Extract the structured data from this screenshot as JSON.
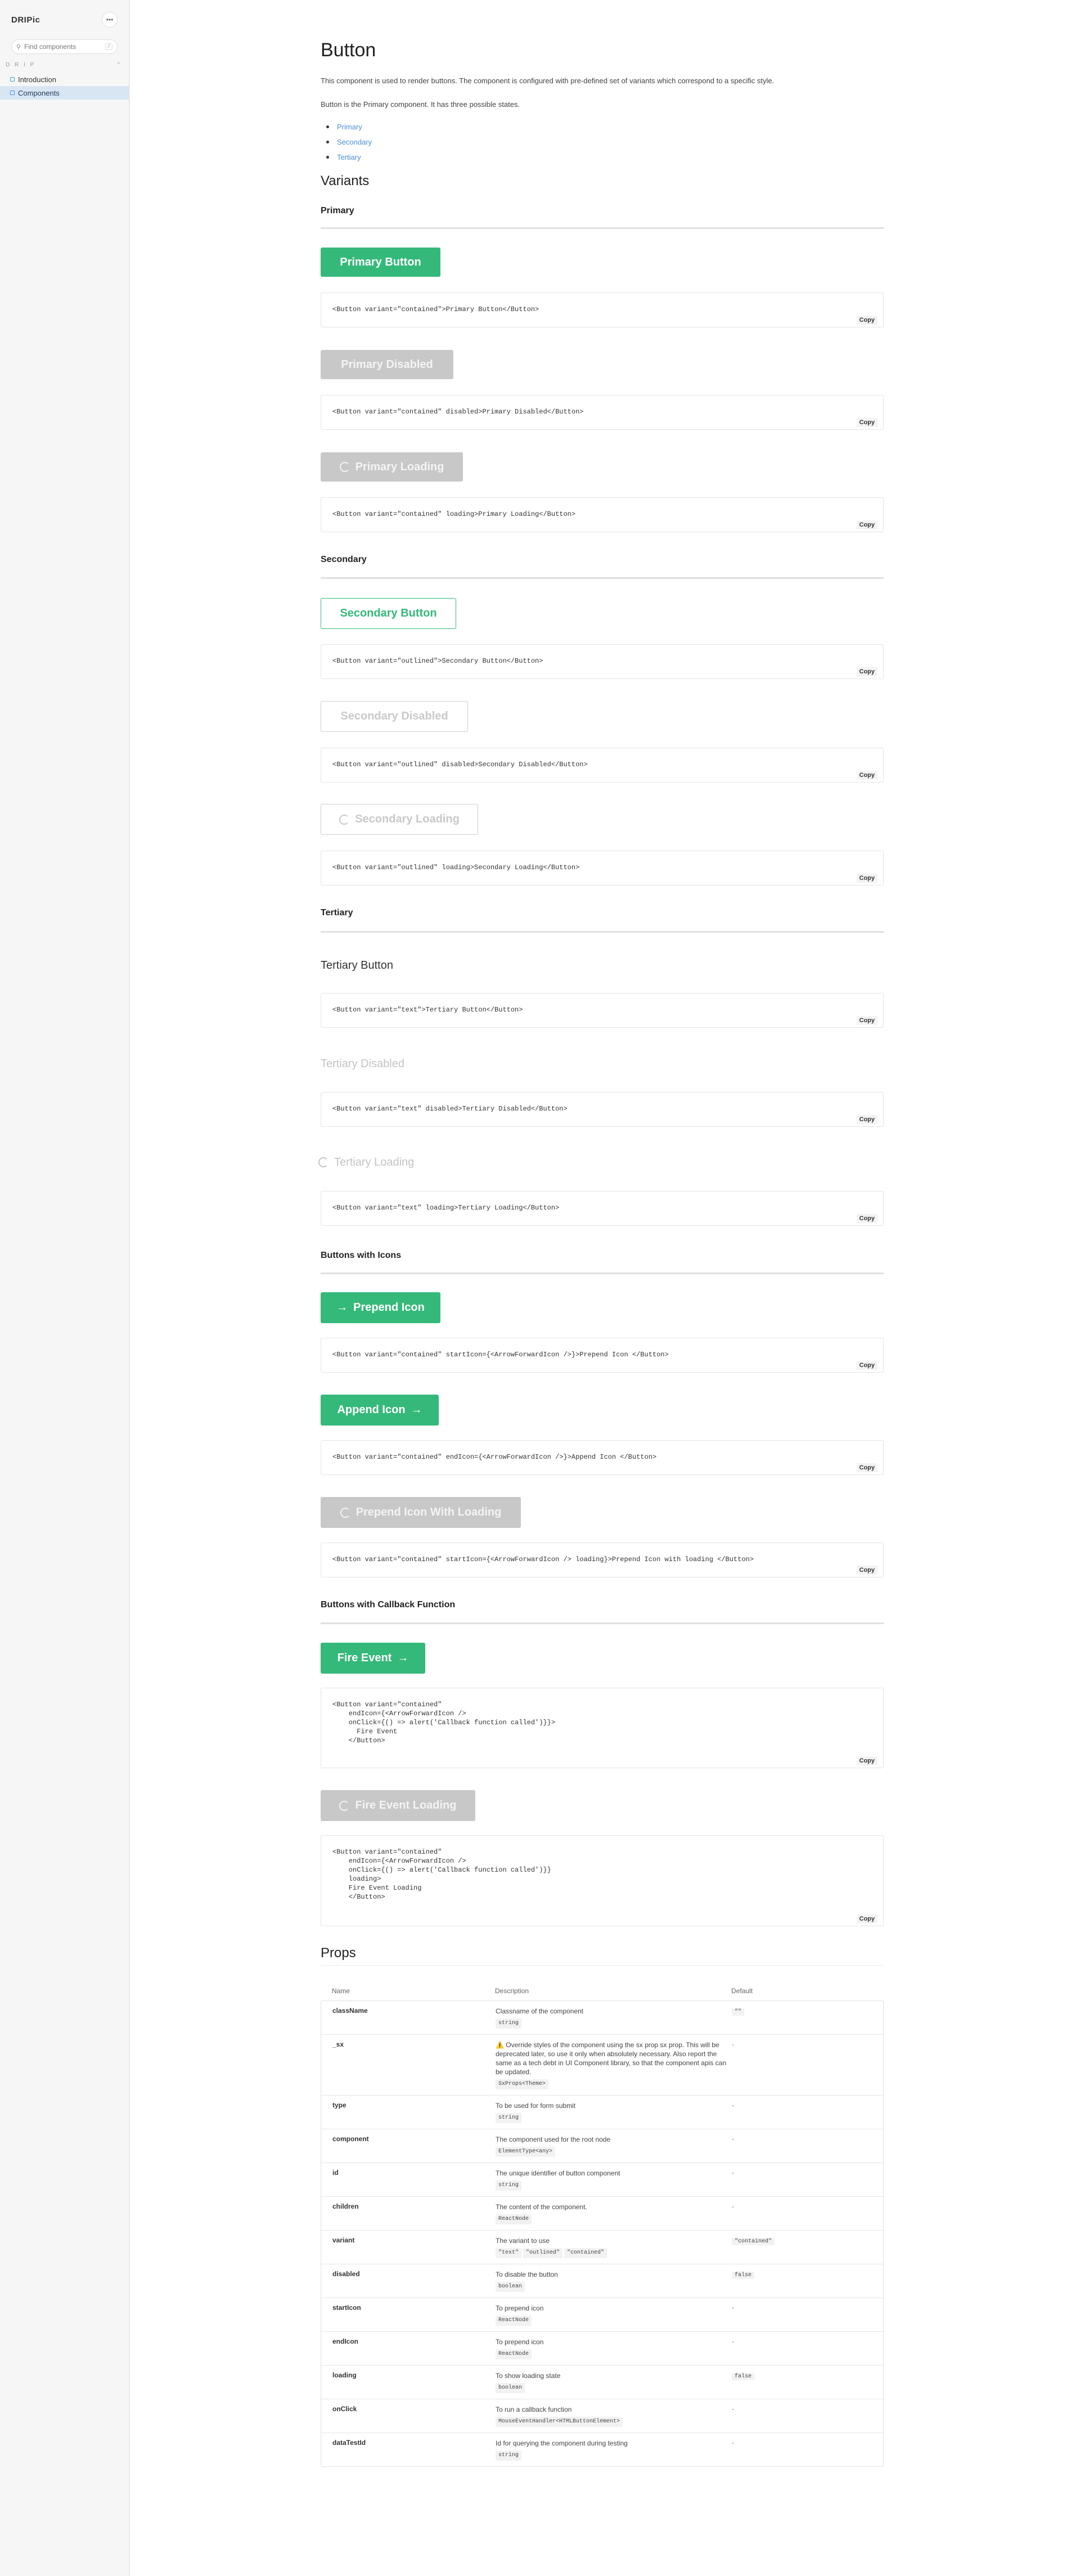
{
  "sidebar": {
    "brand": "DRIPic",
    "menu_icon": "ellipsis-icon",
    "search_placeholder": "Find components",
    "search_kbd": "/",
    "group_label": "D R I P",
    "items": [
      {
        "label": "Introduction",
        "active": false
      },
      {
        "label": "Components",
        "active": true
      }
    ]
  },
  "page": {
    "title": "Button",
    "intro": "This component is used to render buttons. The component is configured with pre-defined set of variants which correspond to a specific style.",
    "sub_intro": "Button is the Primary component. It has three possible states.",
    "links": [
      "Primary",
      "Secondary",
      "Tertiary"
    ],
    "variants_heading": "Variants",
    "copy_label": "Copy"
  },
  "sections": {
    "primary": "Primary",
    "secondary": "Secondary",
    "tertiary": "Tertiary",
    "icons": "Buttons with Icons",
    "callback": "Buttons with Callback Function"
  },
  "buttons": {
    "primary": "Primary Button",
    "primary_disabled": "Primary Disabled",
    "primary_loading": "Primary Loading",
    "secondary": "Secondary Button",
    "secondary_disabled": "Secondary Disabled",
    "secondary_loading": "Secondary Loading",
    "tertiary": "Tertiary Button",
    "tertiary_disabled": "Tertiary Disabled",
    "tertiary_loading": "Tertiary Loading",
    "prepend": "Prepend Icon",
    "append": "Append Icon",
    "prepend_loading": "Prepend Icon With Loading",
    "fire_event": "Fire Event",
    "fire_event_loading": "Fire Event Loading"
  },
  "code": {
    "primary": "<Button variant=\"contained\">Primary Button</Button>",
    "primary_disabled": "<Button variant=\"contained\" disabled>Primary Disabled</Button>",
    "primary_loading": "<Button variant=\"contained\" loading>Primary Loading</Button>",
    "secondary": "<Button variant=\"outlined\">Secondary Button</Button>",
    "secondary_disabled": "<Button variant=\"outlined\" disabled>Secondary Disabled</Button>",
    "secondary_loading": "<Button variant=\"outlined\" loading>Secondary Loading</Button>",
    "tertiary": "<Button variant=\"text\">Tertiary Button</Button>",
    "tertiary_disabled": "<Button variant=\"text\" disabled>Tertiary Disabled</Button>",
    "tertiary_loading": "<Button variant=\"text\" loading>Tertiary Loading</Button>",
    "prepend": "<Button variant=\"contained\" startIcon={<ArrowForwardIcon />}>Prepend Icon </Button>",
    "append": "<Button variant=\"contained\" endIcon={<ArrowForwardIcon />}>Append Icon </Button>",
    "prepend_loading": "<Button variant=\"contained\" startIcon={<ArrowForwardIcon /> loading}>Prepend Icon with loading </Button>",
    "fire_event": "<Button variant=\"contained\"\n    endIcon={<ArrowForwardIcon />\n    onClick={() => alert('Callback function called')}}>\n      Fire Event\n    </Button>",
    "fire_event_loading": "<Button variant=\"contained\"\n    endIcon={<ArrowForwardIcon />\n    onClick={() => alert('Callback function called')}}\n    loading>\n    Fire Event Loading\n    </Button>"
  },
  "props": {
    "heading": "Props",
    "columns": [
      "Name",
      "Description",
      "Default"
    ],
    "rows": [
      {
        "name": "className",
        "desc": "Classname of the component",
        "types": [
          "string"
        ],
        "default": "\"\""
      },
      {
        "name": "_sx",
        "desc": "⚠️ Override styles of the component using the sx prop sx prop. This will be deprecated later, so use it only when absolutely necessary. Also report the same as a tech debt in UI Component library, so that the component apis can be updated.",
        "types": [
          "SxProps<Theme>"
        ],
        "default": "-"
      },
      {
        "name": "type",
        "desc": "To be used for form submit",
        "types": [
          "string"
        ],
        "default": "-"
      },
      {
        "name": "component",
        "desc": "The component used for the root node",
        "types": [
          "ElementType<any>"
        ],
        "default": "-"
      },
      {
        "name": "id",
        "desc": "The unique identifier of button component",
        "types": [
          "string"
        ],
        "default": "-"
      },
      {
        "name": "children",
        "desc": "The content of the component.",
        "types": [
          "ReactNode"
        ],
        "default": "-"
      },
      {
        "name": "variant",
        "desc": "The variant to use",
        "types": [
          "\"text\"",
          "\"outlined\"",
          "\"contained\""
        ],
        "default": "\"contained\""
      },
      {
        "name": "disabled",
        "desc": "To disable the button",
        "types": [
          "boolean"
        ],
        "default": "false"
      },
      {
        "name": "startIcon",
        "desc": "To prepend icon",
        "types": [
          "ReactNode"
        ],
        "default": "-"
      },
      {
        "name": "endIcon",
        "desc": "To prepend icon",
        "types": [
          "ReactNode"
        ],
        "default": "-"
      },
      {
        "name": "loading",
        "desc": "To show loading state",
        "types": [
          "boolean"
        ],
        "default": "false"
      },
      {
        "name": "onClick",
        "desc": "To run a callback function",
        "types": [
          "MouseEventHandler<HTMLButtonElement>"
        ],
        "default": "-"
      },
      {
        "name": "dataTestId",
        "desc": "Id for querying the component during testing",
        "types": [
          "string"
        ],
        "default": "-"
      }
    ]
  },
  "colors": {
    "accent": "#35b97a",
    "link": "#4a90d9",
    "disabled": "#c8c8c8"
  }
}
